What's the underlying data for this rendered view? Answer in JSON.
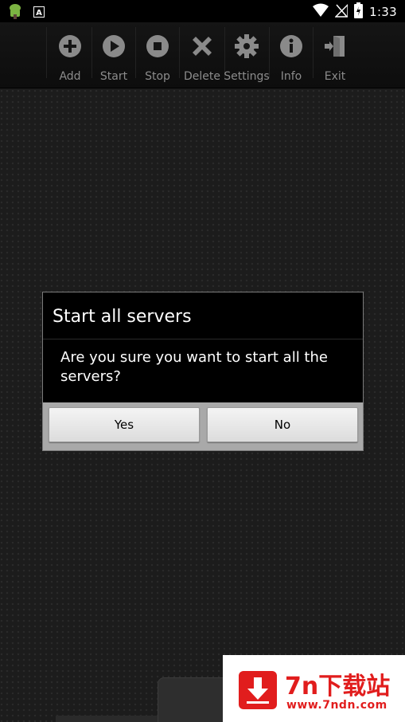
{
  "status_bar": {
    "time": "1:33",
    "left_icons": [
      "android-debug-icon",
      "a-notification-icon"
    ],
    "right_icons": [
      "wifi-icon",
      "no-signal-icon",
      "battery-charging-icon"
    ]
  },
  "toolbar": {
    "items": [
      {
        "label": "Add",
        "icon": "add-icon"
      },
      {
        "label": "Start",
        "icon": "play-icon"
      },
      {
        "label": "Stop",
        "icon": "stop-icon"
      },
      {
        "label": "Delete",
        "icon": "delete-icon"
      },
      {
        "label": "Settings",
        "icon": "gear-icon"
      },
      {
        "label": "Info",
        "icon": "info-icon"
      },
      {
        "label": "Exit",
        "icon": "exit-icon"
      }
    ]
  },
  "dialog": {
    "title": "Start all servers",
    "message": "Are you sure you want to start all the servers?",
    "yes_label": "Yes",
    "no_label": "No"
  },
  "watermark": {
    "title": "7n下载站",
    "url": "www.7ndn.com"
  },
  "colors": {
    "background": "#1c1c1c",
    "toolbar_icon": "#8a8a8a",
    "dialog_bg": "#000000",
    "dialog_button_bar": "#a9a9a9",
    "watermark_red": "#e11d1d"
  }
}
